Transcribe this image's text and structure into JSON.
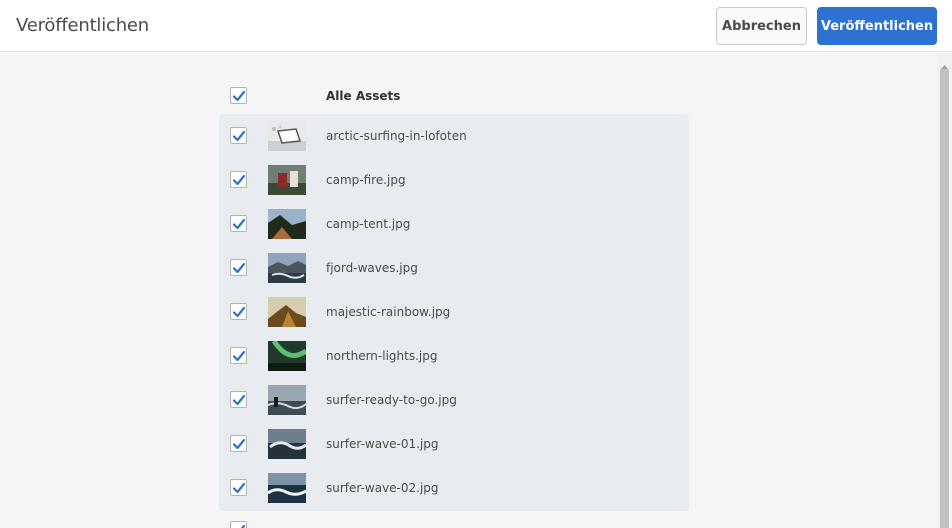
{
  "header": {
    "title": "Veröffentlichen",
    "cancel_label": "Abbrechen",
    "publish_label": "Veröffentlichen"
  },
  "list": {
    "select_all_label": "Alle Assets",
    "items": [
      {
        "label": "arctic-surfing-in-lofoten",
        "thumb": "folder-icon",
        "checked": true
      },
      {
        "label": "camp-fire.jpg",
        "thumb": "image-icon",
        "checked": true
      },
      {
        "label": "camp-tent.jpg",
        "thumb": "image-icon",
        "checked": true
      },
      {
        "label": "fjord-waves.jpg",
        "thumb": "image-icon",
        "checked": true
      },
      {
        "label": "majestic-rainbow.jpg",
        "thumb": "image-icon",
        "checked": true
      },
      {
        "label": "northern-lights.jpg",
        "thumb": "image-icon",
        "checked": true
      },
      {
        "label": "surfer-ready-to-go.jpg",
        "thumb": "image-icon",
        "checked": true
      },
      {
        "label": "surfer-wave-01.jpg",
        "thumb": "image-icon",
        "checked": true
      },
      {
        "label": "surfer-wave-02.jpg",
        "thumb": "image-icon",
        "checked": true
      }
    ]
  },
  "colors": {
    "accent": "#2d72d2",
    "group_bg": "#e8ecf1",
    "check": "#2d72d2"
  }
}
